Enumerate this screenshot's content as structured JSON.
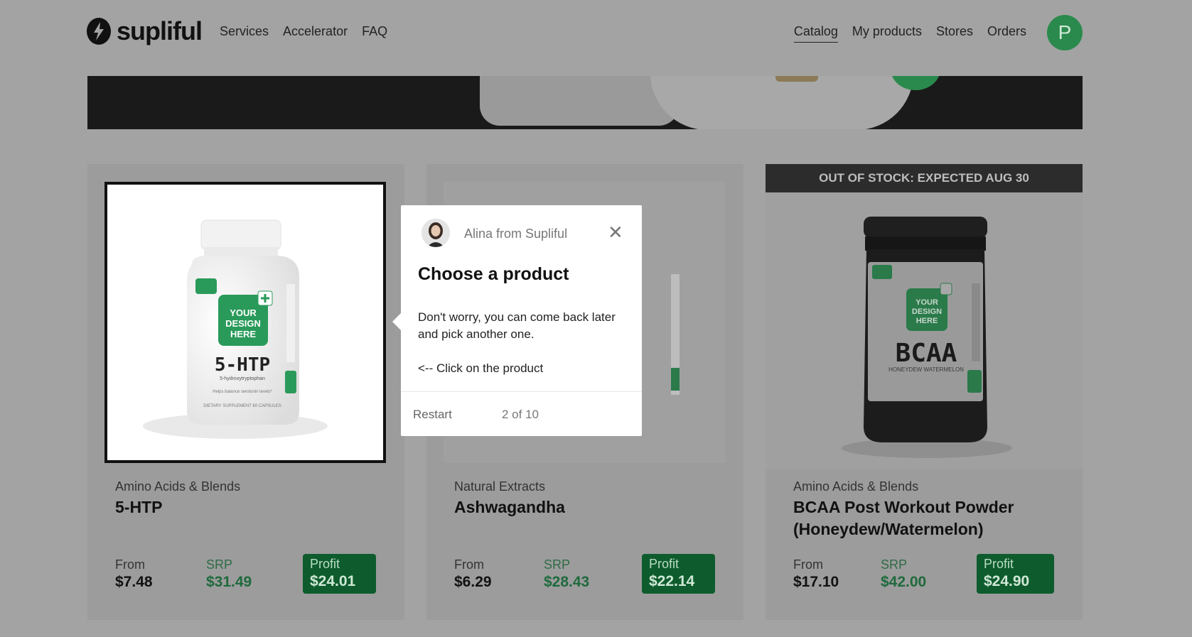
{
  "header": {
    "brand": "supliful",
    "nav_left": [
      "Services",
      "Accelerator",
      "FAQ"
    ],
    "nav_right": [
      "Catalog",
      "My products",
      "Stores",
      "Orders"
    ],
    "active_nav": "Catalog",
    "avatar_letter": "P"
  },
  "products": [
    {
      "category": "Amino Acids & Blends",
      "name": "5-HTP",
      "from_label": "From",
      "from_price": "$7.48",
      "srp_label": "SRP",
      "srp_price": "$31.49",
      "profit_label": "Profit",
      "profit_price": "$24.01",
      "label_text": [
        "YOUR",
        "DESIGN",
        "HERE"
      ],
      "bottle_name": "5-HTP",
      "bottle_sub": "5-hydroxytryptophan",
      "bottle_tag": "Helps balance serotonin levels*",
      "bottle_foot": "DIETARY SUPPLEMENT    60 CAPSULES"
    },
    {
      "category": "Natural Extracts",
      "name": "Ashwagandha",
      "from_label": "From",
      "from_price": "$6.29",
      "srp_label": "SRP",
      "srp_price": "$28.43",
      "profit_label": "Profit",
      "profit_price": "$22.14"
    },
    {
      "stock_banner": "OUT OF STOCK: EXPECTED AUG 30",
      "category": "Amino Acids & Blends",
      "name": "BCAA Post Workout Powder (Honeydew/Watermelon)",
      "from_label": "From",
      "from_price": "$17.10",
      "srp_label": "SRP",
      "srp_price": "$42.00",
      "profit_label": "Profit",
      "profit_price": "$24.90",
      "label_text": [
        "YOUR",
        "DESIGN",
        "HERE"
      ],
      "tub_name": "BCAA",
      "tub_sub": "HONEYDEW WATERMELON"
    }
  ],
  "tooltip": {
    "from": "Alina from Supliful",
    "title": "Choose a product",
    "body": "Don't worry, you can come back later and pick another one.",
    "hint": "<-- Click on the product",
    "restart": "Restart",
    "step": "2 of 10"
  },
  "colors": {
    "accent_green": "#2a8a4d",
    "profit_bg": "#0e5c2d",
    "overlay_gray": "#a3a3a3"
  }
}
